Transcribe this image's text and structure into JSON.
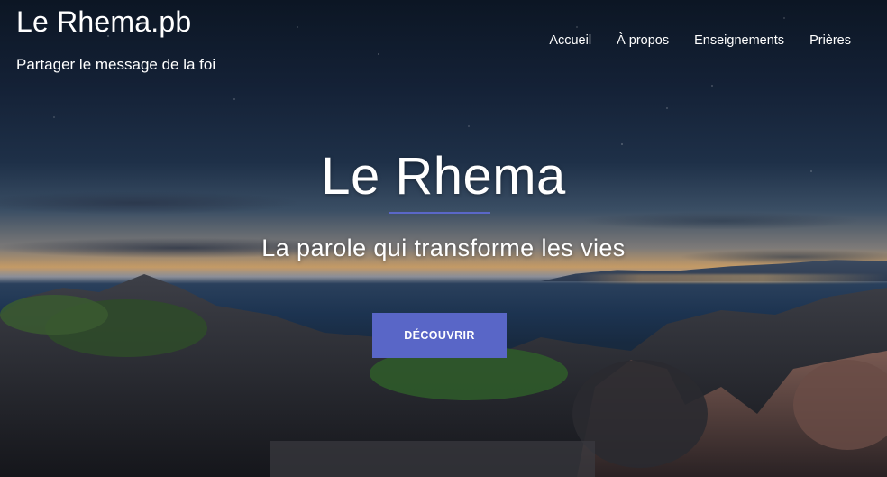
{
  "site": {
    "title": "Le Rhema.pb",
    "tagline": "Partager le message de la foi"
  },
  "nav": {
    "items": [
      {
        "label": "Accueil"
      },
      {
        "label": "À propos"
      },
      {
        "label": "Enseignements"
      },
      {
        "label": "Prières"
      }
    ]
  },
  "hero": {
    "heading": "Le Rhema",
    "subheading": "La parole qui transforme les vies",
    "button_label": "DÉCOUVRIR",
    "accent_color": "#5966c7",
    "background_image": "night-seascape-with-rocks"
  }
}
